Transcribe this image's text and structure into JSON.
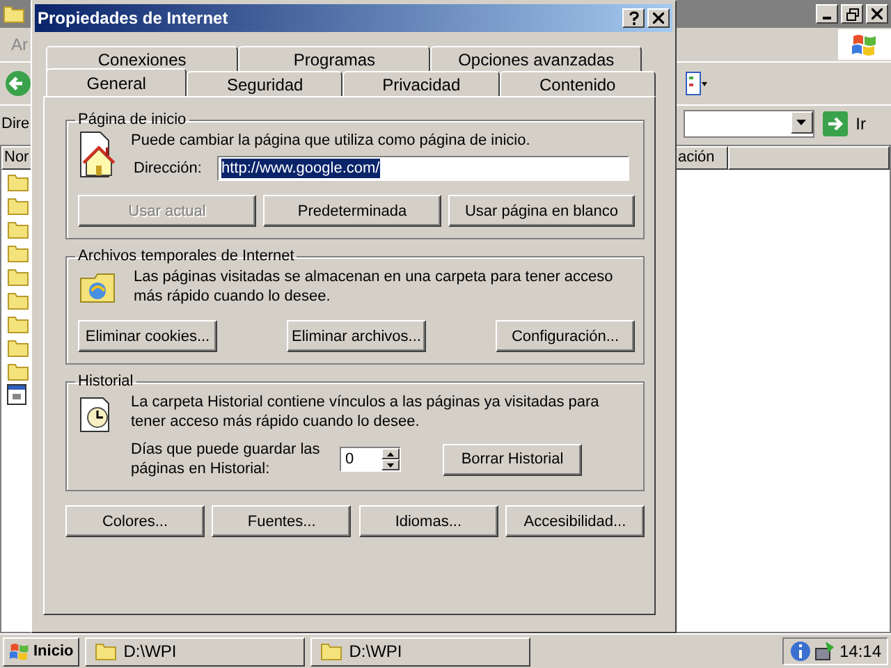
{
  "background_window": {
    "menu_fragment": "Ar",
    "address_fragment": "Dire",
    "go_label": "Ir",
    "columns": [
      {
        "label": "Nor"
      },
      {
        "label": "ación"
      }
    ],
    "files": [
      {
        "kind": "folder"
      },
      {
        "kind": "folder"
      },
      {
        "kind": "folder"
      },
      {
        "kind": "folder"
      },
      {
        "kind": "folder"
      },
      {
        "kind": "folder"
      },
      {
        "kind": "folder"
      },
      {
        "kind": "folder"
      },
      {
        "kind": "folder"
      },
      {
        "kind": "file"
      }
    ]
  },
  "dialog": {
    "title": "Propiedades de Internet",
    "tab_rows": [
      [
        {
          "label": "Conexiones",
          "selected": false
        },
        {
          "label": "Programas",
          "selected": false
        },
        {
          "label": "Opciones avanzadas",
          "selected": false
        }
      ],
      [
        {
          "label": "General",
          "selected": true
        },
        {
          "label": "Seguridad",
          "selected": false
        },
        {
          "label": "Privacidad",
          "selected": false
        },
        {
          "label": "Contenido",
          "selected": false
        }
      ]
    ],
    "home_page": {
      "title": "Página de inicio",
      "description": "Puede cambiar la página que utiliza como página de inicio.",
      "address_label": "Dirección:",
      "address_value": "http://www.google.com/",
      "buttons": [
        {
          "label": "Usar actual",
          "disabled": true
        },
        {
          "label": "Predeterminada",
          "disabled": false
        },
        {
          "label": "Usar página en blanco",
          "disabled": false
        }
      ]
    },
    "temp_files": {
      "title": "Archivos temporales de Internet",
      "description": "Las páginas visitadas se almacenan en una carpeta para tener acceso más rápido cuando lo desee.",
      "buttons": [
        {
          "label": "Eliminar cookies...",
          "disabled": false
        },
        {
          "label": "Eliminar archivos...",
          "disabled": false
        },
        {
          "label": "Configuración...",
          "disabled": false
        }
      ]
    },
    "history": {
      "title": "Historial",
      "description": "La carpeta Historial contiene vínculos a las páginas ya visitadas para tener acceso más rápido cuando lo desee.",
      "days_label": "Días que puede guardar las páginas en Historial:",
      "days_value": "0",
      "clear_button": "Borrar Historial"
    },
    "buttons": [
      {
        "label": "Colores..."
      },
      {
        "label": "Fuentes..."
      },
      {
        "label": "Idiomas..."
      },
      {
        "label": "Accesibilidad..."
      }
    ]
  },
  "taskbar": {
    "start": "Inicio",
    "tasks": [
      {
        "label": "D:\\WPI"
      },
      {
        "label": "D:\\WPI"
      }
    ],
    "clock": "14:14"
  }
}
